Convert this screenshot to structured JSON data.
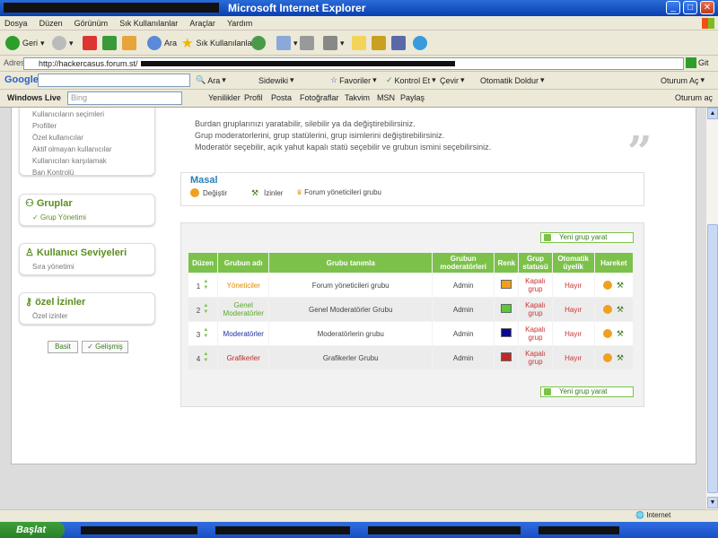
{
  "window": {
    "title": "Microsoft Internet Explorer"
  },
  "menu": [
    "Dosya",
    "Düzen",
    "Görünüm",
    "Sık Kullanılanlar",
    "Araçlar",
    "Yardım"
  ],
  "toolbar": {
    "back": "Geri",
    "search": "Ara",
    "favorites": "Sık Kullanılanlar"
  },
  "address": {
    "label": "Adres",
    "url": "http://hackercasus.forum.st/",
    "go": "Git"
  },
  "google_bar": {
    "logo": "Google",
    "search_label": "Ara",
    "sidewiki": "Sidewiki",
    "favorites": "Favoriler",
    "check": "Kontrol Et",
    "translate": "Çevir",
    "autofill": "Otomatik Doldur",
    "signin": "Oturum Aç"
  },
  "live_bar": {
    "brand": "Windows Live",
    "search_placeholder": "Bing",
    "items": [
      "Yenilikler",
      "Profil",
      "Posta",
      "Fotoğraflar",
      "Takvim",
      "MSN",
      "Paylaş"
    ],
    "signin": "Oturum aç"
  },
  "sidebar": {
    "top_items": [
      "Kullanıcıların seçimleri",
      "Profiller",
      "Özel kullanıcılar",
      "Aktif olmayan kullanıcılar",
      "Kullanıcıları karşılamak",
      "Ban Kontrolü"
    ],
    "groups": {
      "title": "Gruplar",
      "items": [
        "Grup Yönetimi"
      ]
    },
    "levels": {
      "title": "Kullanıcı Seviyeleri",
      "items": [
        "Sıra yönetimi"
      ]
    },
    "perms": {
      "title": "özel İzinler",
      "items": [
        "Özel izinler"
      ]
    },
    "mode_basic": "Basit",
    "mode_advanced": "Gelişmiş"
  },
  "description": [
    "Burdan gruplarınızı yaratabilir, silebilir ya da değiştirebilirsiniz.",
    "Grup moderatorlerini, grup statülerini, grup isimlerini değiştirebilirsiniz.",
    "Moderatör seçebilir, açık yahut kapalı statü seçebilir ve grubun ismini seçebilirsiniz."
  ],
  "masal": {
    "title": "Masal",
    "edit": "Değiştir",
    "perms": "İzinler",
    "group": "Forum yöneticileri grubu"
  },
  "groups_panel": {
    "new_group": "Yeni grup yarat",
    "headers": [
      "Düzen",
      "Grubun adı",
      "Grubu tanımla",
      "Grubun moderatörleri",
      "Renk",
      "Grup statusü",
      "Otomatik üyelik",
      "Hareket"
    ],
    "rows": [
      {
        "order": "1",
        "name": "Yöneticiler",
        "name_color": "#e08a00",
        "desc": "Forum yöneticileri grubu",
        "moderator": "Admin",
        "color": "#f0a020",
        "status": "Kapalı grup",
        "auto": "Hayır"
      },
      {
        "order": "2",
        "name": "Genel Moderatörler",
        "name_color": "#5aa82a",
        "desc": "Genel Moderatörler Grubu",
        "moderator": "Admin",
        "color": "#5ac83a",
        "status": "Kapalı grup",
        "auto": "Hayır"
      },
      {
        "order": "3",
        "name": "Moderatörler",
        "name_color": "#1a2fa0",
        "desc": "Moderatörlerin grubu",
        "moderator": "Admin",
        "color": "#0a0a90",
        "status": "Kapalı grup",
        "auto": "Hayır"
      },
      {
        "order": "4",
        "name": "Grafikerler",
        "name_color": "#c0282a",
        "desc": "Grafikerler Grubu",
        "moderator": "Admin",
        "color": "#c02828",
        "status": "Kapalı grup",
        "auto": "Hayır"
      }
    ]
  },
  "status": {
    "zone": "Internet"
  },
  "taskbar": {
    "start": "Başlat"
  }
}
